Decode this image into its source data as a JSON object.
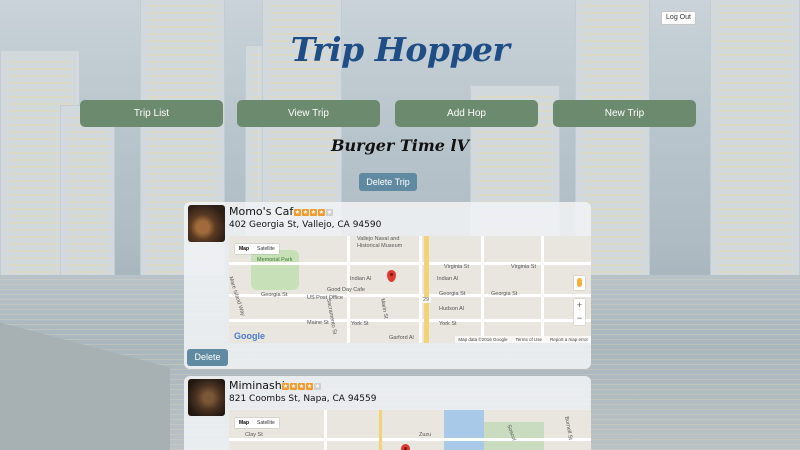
{
  "header": {
    "logout_label": "Log Out",
    "app_title": "Trip Hopper"
  },
  "nav": [
    {
      "label": "Trip List"
    },
    {
      "label": "View Trip"
    },
    {
      "label": "Add Hop"
    },
    {
      "label": "New Trip"
    }
  ],
  "trip": {
    "name": "Burger Time lV",
    "delete_label": "Delete Trip"
  },
  "hops": [
    {
      "name": "Momo's Cafe",
      "rating": 4,
      "address": "402 Georgia St, Vallejo, CA 94590",
      "map": {
        "toggle": [
          "Map",
          "Satellite"
        ],
        "labels": [
          "Vallejo Naval and",
          "Historical Museum",
          "Memorial Park",
          "Virginia St",
          "Virginia St",
          "Indian Al",
          "Indian Al",
          "Good Day Cafe",
          "US Post Office",
          "Georgia St",
          "Georgia St",
          "Georgia St",
          "Mare Island Way",
          "Sacramento St",
          "Marin St",
          "Hudson Al",
          "York St",
          "York St",
          "Garford Al",
          "Maine St",
          "29"
        ],
        "attribution": [
          "Map data ©2016 Google",
          "Terms of Use",
          "Report a map error"
        ],
        "brand": "Google",
        "zoom": [
          "+",
          "−"
        ]
      },
      "delete_label": "Delete"
    },
    {
      "name": "Miminashi",
      "rating": 4,
      "address": "821 Coombs St, Napa, CA 94559",
      "map": {
        "toggle": [
          "Map",
          "Satellite"
        ],
        "labels": [
          "Clay St",
          "Zuzu",
          "Soscol",
          "Burnell St"
        ]
      }
    }
  ],
  "colors": {
    "nav_button": "#6b8a6e",
    "action_button": "#5f8aa2",
    "title": "#1f4e86",
    "star": "#f29a2e"
  }
}
